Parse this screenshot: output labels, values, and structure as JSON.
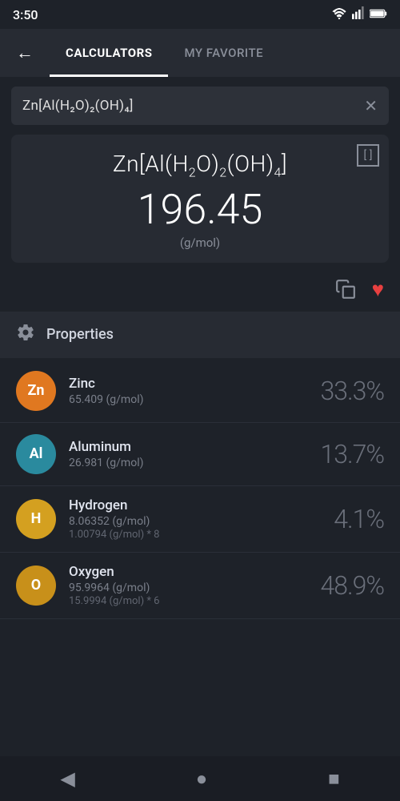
{
  "statusBar": {
    "time": "3:50"
  },
  "nav": {
    "backLabel": "←",
    "tabs": [
      {
        "id": "calculators",
        "label": "CALCULATORS",
        "active": true
      },
      {
        "id": "myfavorite",
        "label": "MY FAVORITE",
        "active": false
      }
    ]
  },
  "searchBar": {
    "value": "Zn[Al(H₂O)₂(OH)₄]",
    "clearLabel": "✕"
  },
  "formulaArea": {
    "formula": "Zn[Al(H₂O)₂(OH)₄]",
    "molecularWeight": "196.45",
    "unit": "(g/mol)",
    "expandLabel": "[ ]"
  },
  "actions": {
    "copyLabel": "⧉",
    "favoriteLabel": "♥"
  },
  "properties": {
    "icon": "⚙",
    "title": "Properties",
    "elements": [
      {
        "symbol": "Zn",
        "badgeClass": "badge-orange",
        "name": "Zinc",
        "mol": "65.409 (g/mol)",
        "detail": "",
        "percent": "33.3%"
      },
      {
        "symbol": "Al",
        "badgeClass": "badge-teal",
        "name": "Aluminum",
        "mol": "26.981 (g/mol)",
        "detail": "",
        "percent": "13.7%"
      },
      {
        "symbol": "H",
        "badgeClass": "badge-yellow",
        "name": "Hydrogen",
        "mol": "8.06352 (g/mol)",
        "detail": "1.00794 (g/mol) * 8",
        "percent": "4.1%"
      },
      {
        "symbol": "O",
        "badgeClass": "badge-gold",
        "name": "Oxygen",
        "mol": "95.9964 (g/mol)",
        "detail": "15.9994 (g/mol) * 6",
        "percent": "48.9%"
      }
    ]
  },
  "bottomNav": {
    "backLabel": "◀",
    "homeLabel": "●",
    "recentLabel": "■"
  }
}
